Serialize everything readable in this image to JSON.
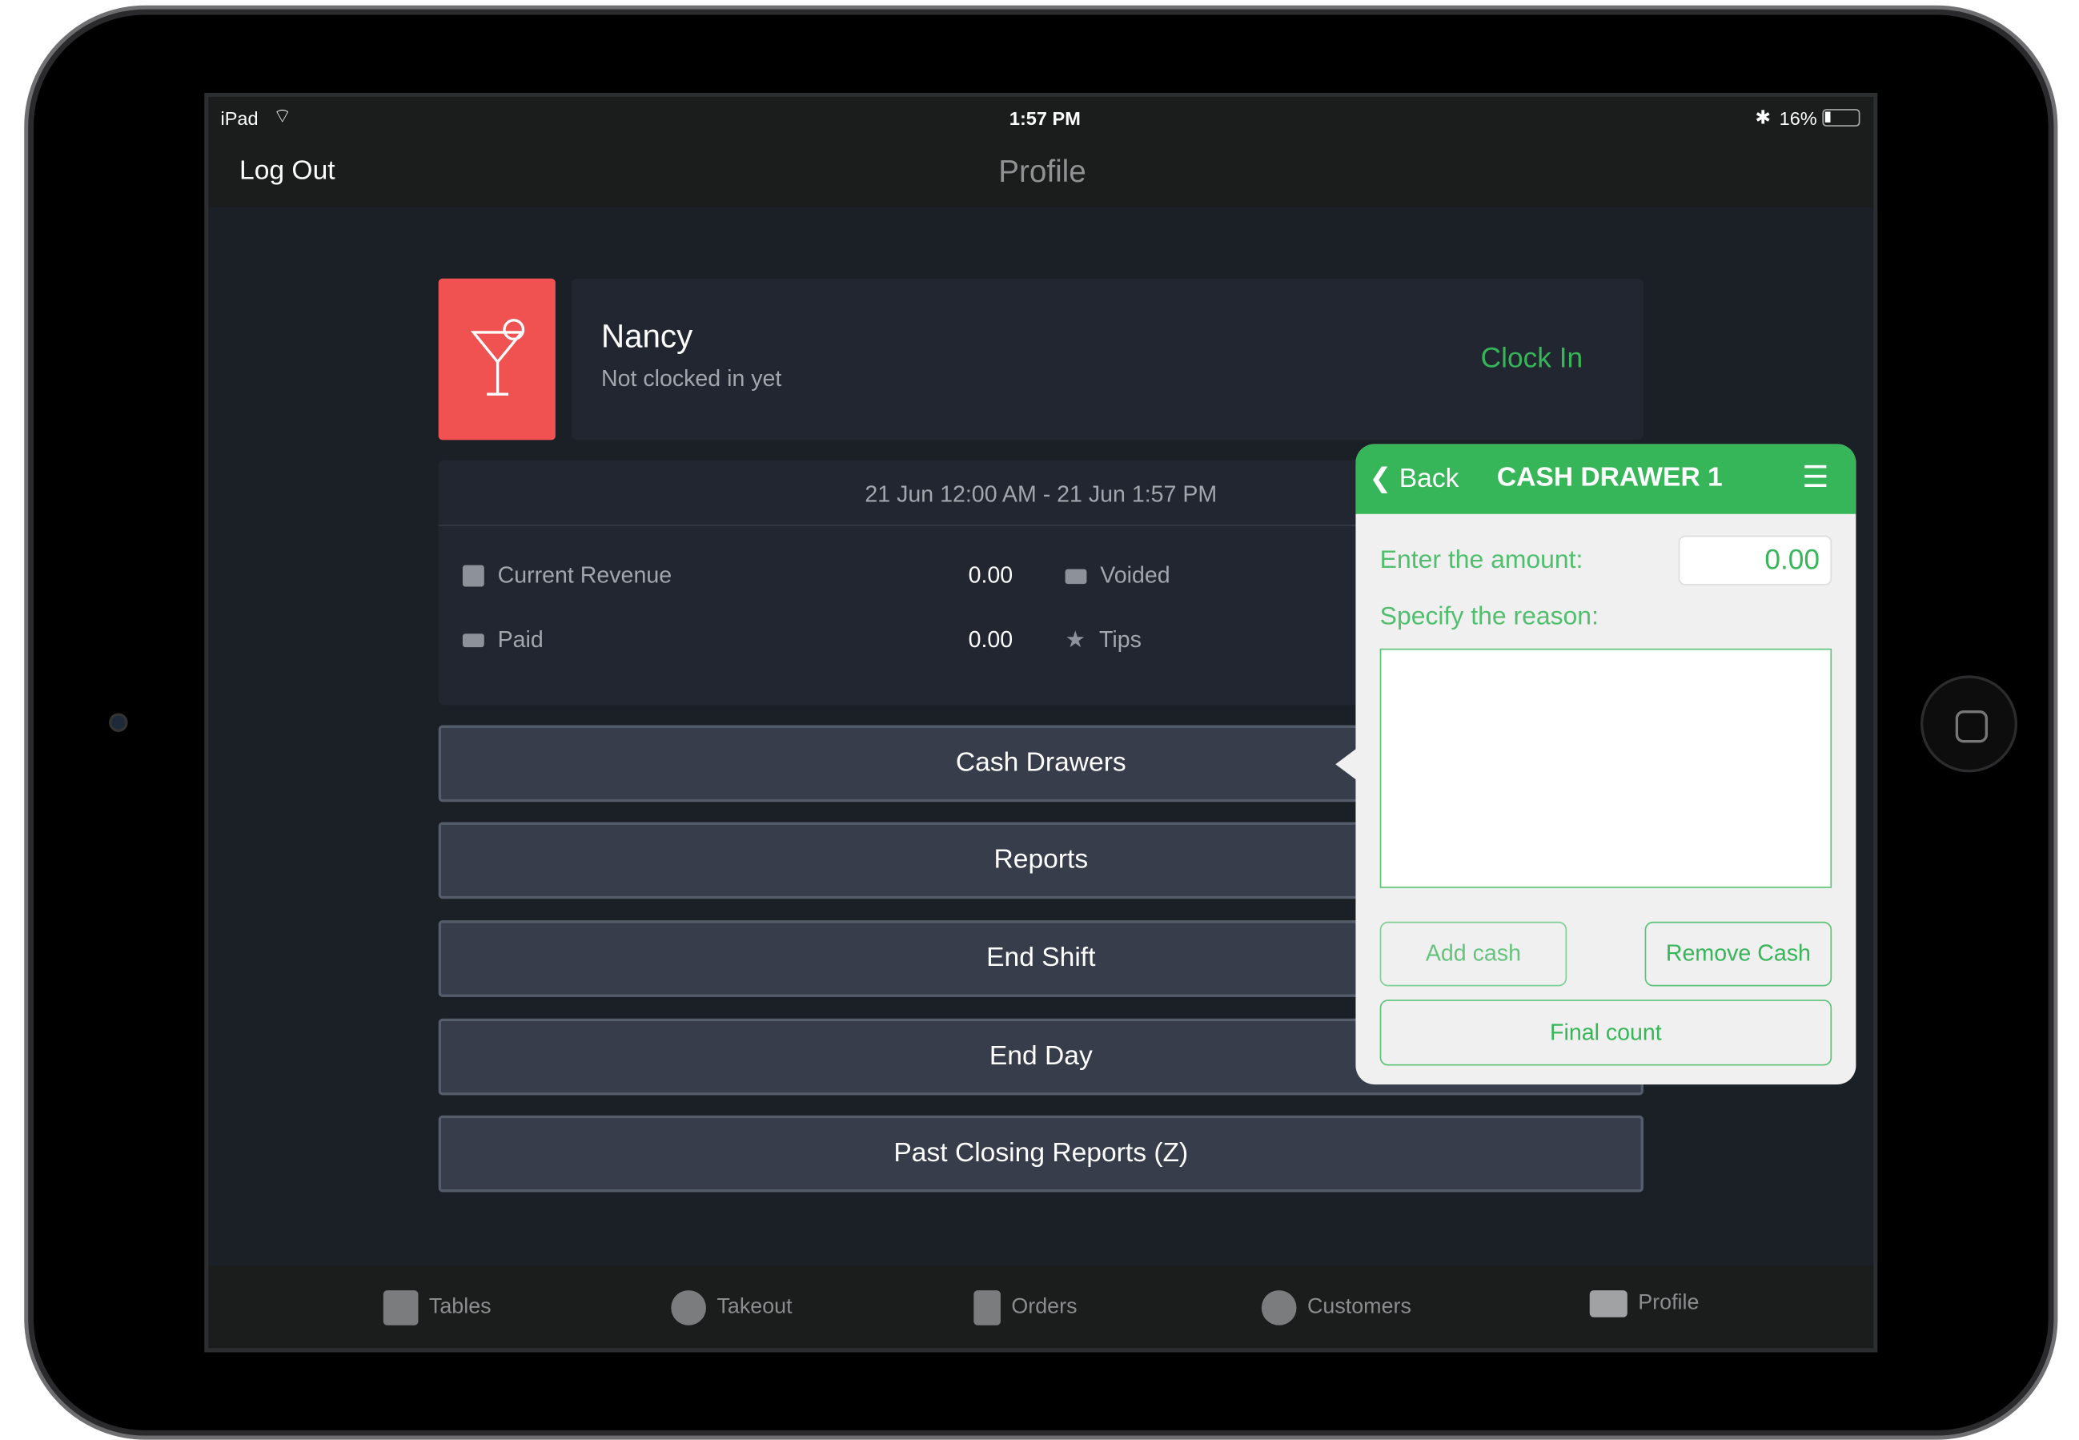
{
  "status_bar": {
    "device": "iPad",
    "time": "1:57 PM",
    "battery": "16%"
  },
  "nav": {
    "left_button": "Log Out",
    "title": "Profile"
  },
  "profile": {
    "name": "Nancy",
    "status": "Not clocked in yet",
    "action": "Clock In"
  },
  "summary": {
    "period": "21 Jun 12:00 AM - 21 Jun 1:57 PM",
    "stats": [
      {
        "label": "Current Revenue",
        "value": "0.00",
        "icon": "register-icon"
      },
      {
        "label": "Paid",
        "value": "0.00",
        "icon": "card-icon"
      },
      {
        "label": "Voided",
        "icon": "voided-icon"
      },
      {
        "label": "Tips",
        "icon": "star-icon"
      }
    ]
  },
  "buttons": [
    "Cash Drawers",
    "Reports",
    "End Shift",
    "End Day",
    "Past Closing Reports (Z)"
  ],
  "popover": {
    "back": "Back",
    "title": "CASH DRAWER 1",
    "amount_label": "Enter the amount:",
    "amount_value": "0.00",
    "reason_label": "Specify the reason:",
    "reason_value": "",
    "add": "Add cash",
    "remove": "Remove Cash",
    "final": "Final count"
  },
  "tabs": [
    {
      "label": "Tables",
      "icon": "tables-icon"
    },
    {
      "label": "Takeout",
      "icon": "takeout-icon"
    },
    {
      "label": "Orders",
      "icon": "orders-icon"
    },
    {
      "label": "Customers",
      "icon": "customers-icon"
    },
    {
      "label": "Profile",
      "icon": "profile-icon"
    }
  ],
  "colors": {
    "accent": "#36b658",
    "avatar": "#f05252",
    "background": "#1b1f26"
  }
}
